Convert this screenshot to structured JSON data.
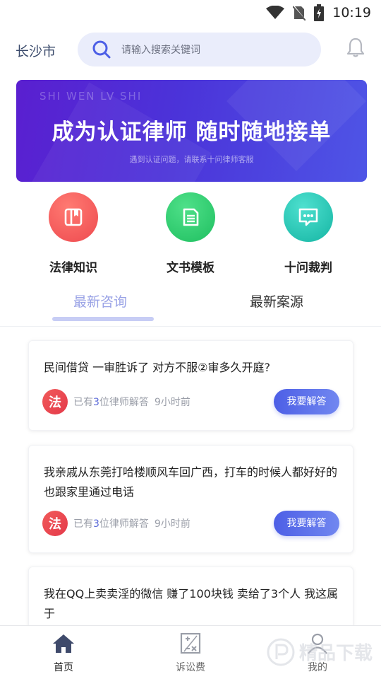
{
  "status_bar": {
    "time": "10:19"
  },
  "header": {
    "city": "长沙市",
    "search_placeholder": "请输入搜索关键词"
  },
  "banner": {
    "en_text": "SHI WEN LV SHI",
    "title": "成为认证律师  随时随地接单",
    "subtitle": "遇到认证问题，请联系十问律师客服"
  },
  "entries": [
    {
      "label": "法律知识",
      "icon": "book-icon",
      "color": "#f0605e"
    },
    {
      "label": "文书模板",
      "icon": "document-icon",
      "color": "#2fcf74"
    },
    {
      "label": "十问裁判",
      "icon": "chat-icon",
      "color": "#26c5b5"
    }
  ],
  "tabs": {
    "active": "最新咨询",
    "inactive": "最新案源"
  },
  "cards": [
    {
      "question": "民间借贷 一审胜诉了 对方不服②审多久开庭?",
      "avatar": "法",
      "meta_prefix": "已有",
      "count": "3",
      "meta_suffix": "位律师解答",
      "time": "9小时前",
      "button": "我要解答"
    },
    {
      "question": "我亲戚从东莞打哈楼顺风车回广西，打车的时候人都好好的 也跟家里通过电话",
      "avatar": "法",
      "meta_prefix": "已有",
      "count": "3",
      "meta_suffix": "位律师解答",
      "time": "9小时前",
      "button": "我要解答"
    },
    {
      "question": "我在QQ上卖卖淫的微信 赚了100块钱 卖给了3个人 我这属于"
    }
  ],
  "bottom_nav": [
    {
      "label": "首页",
      "icon": "home-icon",
      "active": true
    },
    {
      "label": "诉讼费",
      "icon": "calculator-icon",
      "active": false
    },
    {
      "label": "我的",
      "icon": "user-icon",
      "active": false
    }
  ],
  "watermark": {
    "text": "P 精品下载"
  },
  "colors": {
    "accent": "#4d5fe6",
    "tab_active": "#9aa3e6",
    "meta_highlight": "#5b6ad8"
  }
}
